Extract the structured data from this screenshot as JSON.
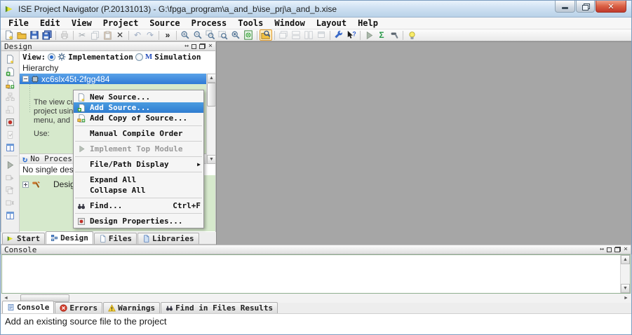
{
  "titlebar": {
    "title": "ISE Project Navigator (P.20131013) - G:\\fpga_program\\a_and_b\\ise_prj\\a_and_b.xise"
  },
  "menubar": {
    "items": [
      "File",
      "Edit",
      "View",
      "Project",
      "Source",
      "Process",
      "Tools",
      "Window",
      "Layout",
      "Help"
    ]
  },
  "toolbar": {
    "icons": [
      "new-document",
      "open-folder",
      "save",
      "save-all",
      "print",
      "cut",
      "copy",
      "paste",
      "delete",
      "undo",
      "redo",
      "overflow-chevron",
      "zoom-in",
      "zoom-out",
      "zoom-box",
      "zoom-fit",
      "zoom-full",
      "html-report",
      "pan-view",
      "cascade-windows",
      "tile-horizontal",
      "tile-vertical",
      "close-window",
      "wrench",
      "help-pointer",
      "run",
      "sigma",
      "implement-tool",
      "lightbulb"
    ]
  },
  "design_panel": {
    "title": "Design",
    "view": {
      "label": "View:",
      "implementation": "Implementation",
      "simulation": "Simulation"
    },
    "hierarchy_label": "Hierarchy",
    "device_name": "xc6slx45t-2fgg484",
    "empty_view_lines": [
      "The view cu",
      "project usin",
      "menu, and",
      "Use:"
    ],
    "processes_label": "No Processe",
    "no_selection_text": "No single desig",
    "process_tree_item": "Design",
    "tabs": {
      "start": "Start",
      "design": "Design",
      "files": "Files",
      "libraries": "Libraries"
    }
  },
  "context_menu": {
    "items": [
      {
        "label": "New Source..."
      },
      {
        "label": "Add Source...",
        "highlighted": true
      },
      {
        "label": "Add Copy of Source..."
      },
      {
        "label": "Manual Compile Order"
      },
      {
        "label": "Implement Top Module",
        "disabled": true
      },
      {
        "label": "File/Path Display",
        "submenu": true
      },
      {
        "label": "Expand All"
      },
      {
        "label": "Collapse All"
      },
      {
        "label": "Find...",
        "shortcut": "Ctrl+F"
      },
      {
        "label": "Design Properties..."
      }
    ]
  },
  "console_panel": {
    "title": "Console",
    "tabs": {
      "console": "Console",
      "errors": "Errors",
      "warnings": "Warnings",
      "find": "Find in Files Results"
    }
  },
  "statusbar": {
    "text": "Add an existing source file to the project"
  },
  "colors": {
    "selection_blue": "#2f7ad6",
    "panel_green": "#d6e9cc",
    "workspace_gray": "#a6a6a6",
    "close_button_red": "#c0392b",
    "toolbar_highlight": "#e09a2a"
  }
}
